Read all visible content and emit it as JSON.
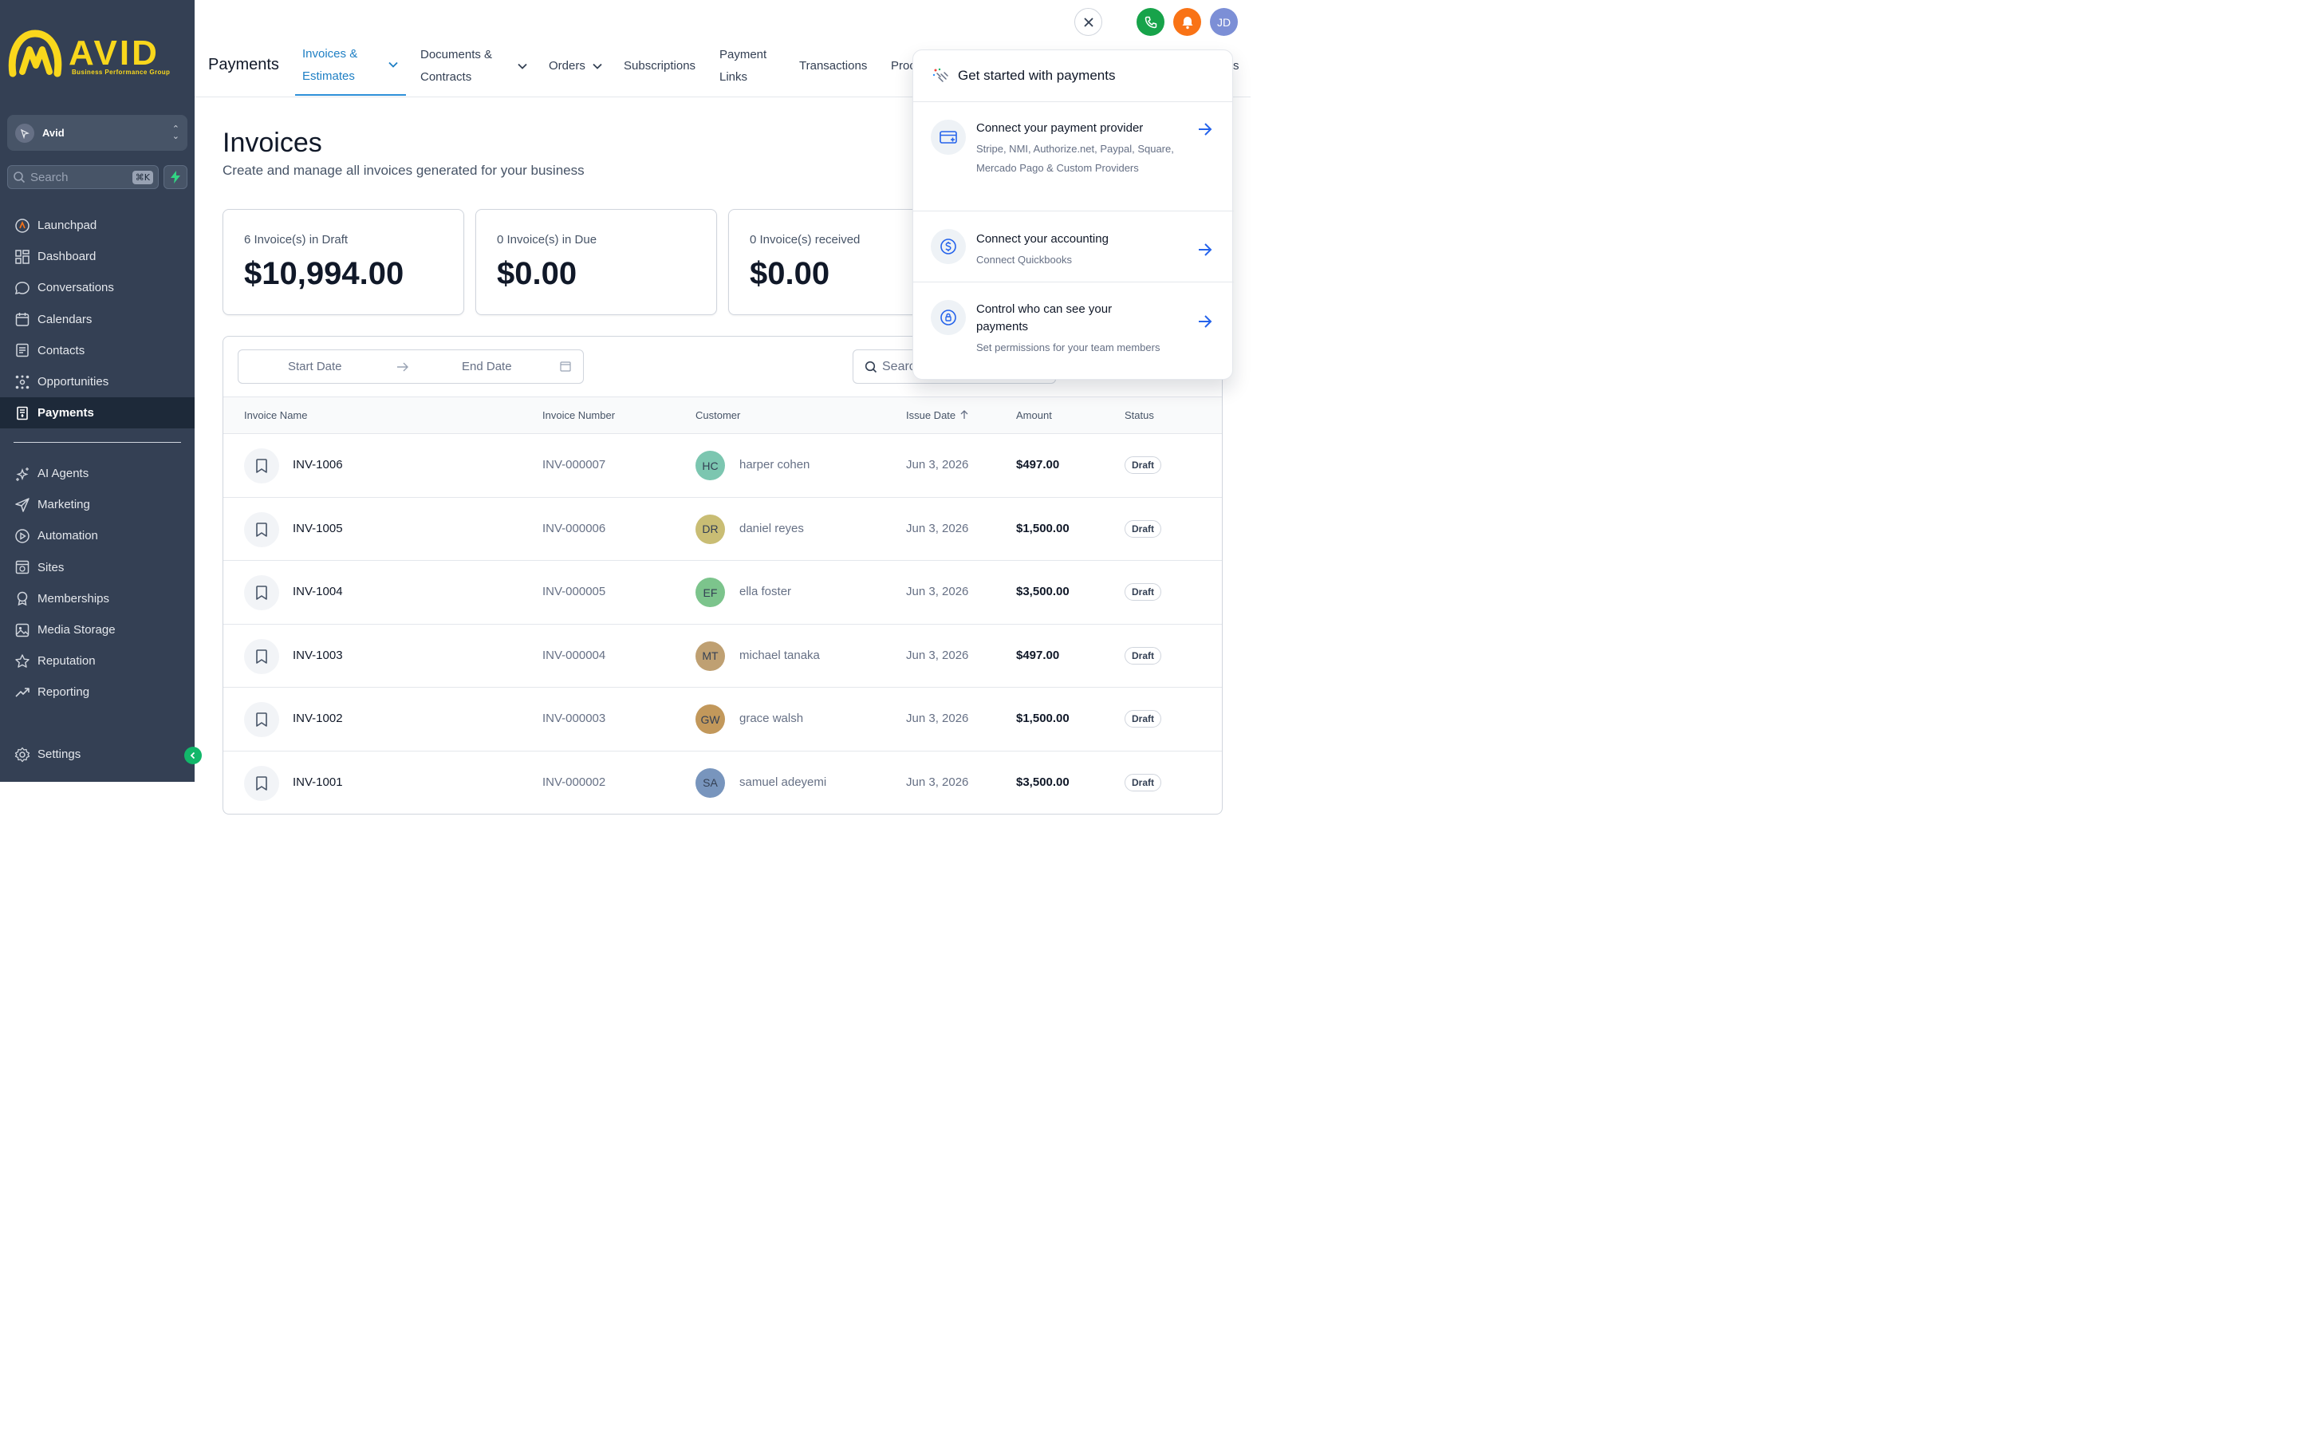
{
  "brand": {
    "name": "AVID",
    "tagline": "Business Performance Group",
    "color": "#f9d71c"
  },
  "sidebar": {
    "account": "Avid",
    "search_placeholder": "Search",
    "search_shortcut": "⌘K",
    "items": [
      {
        "label": "Launchpad",
        "icon": "launchpad-icon"
      },
      {
        "label": "Dashboard",
        "icon": "dashboard-icon"
      },
      {
        "label": "Conversations",
        "icon": "chat-icon"
      },
      {
        "label": "Calendars",
        "icon": "calendar-icon"
      },
      {
        "label": "Contacts",
        "icon": "contacts-icon"
      },
      {
        "label": "Opportunities",
        "icon": "opportunities-icon"
      },
      {
        "label": "Payments",
        "icon": "payments-icon",
        "active": true
      }
    ],
    "items2": [
      {
        "label": "AI Agents",
        "icon": "sparkle-icon"
      },
      {
        "label": "Marketing",
        "icon": "send-icon"
      },
      {
        "label": "Automation",
        "icon": "automation-icon"
      },
      {
        "label": "Sites",
        "icon": "sites-icon"
      },
      {
        "label": "Memberships",
        "icon": "membership-icon"
      },
      {
        "label": "Media Storage",
        "icon": "image-icon"
      },
      {
        "label": "Reputation",
        "icon": "star-icon"
      },
      {
        "label": "Reporting",
        "icon": "trend-icon"
      }
    ],
    "settings": "Settings"
  },
  "header": {
    "title": "Payments",
    "tabs": {
      "invoices_l1": "Invoices &",
      "invoices_l2": "Estimates",
      "documents_l1": "Documents &",
      "documents_l2": "Contracts",
      "orders": "Orders",
      "subscriptions": "Subscriptions",
      "links_l1": "Payment",
      "links_l2": "Links",
      "transactions": "Transactions",
      "products": "Proc",
      "more": "s"
    },
    "avatar": "JD",
    "colors": {
      "phone": "#17a34a",
      "bell": "#f97316",
      "avatar": "#7c8fd6"
    }
  },
  "page": {
    "title": "Invoices",
    "subtitle": "Create and manage all invoices generated for your business"
  },
  "cards": [
    {
      "label": "6 Invoice(s) in Draft",
      "value": "$10,994.00"
    },
    {
      "label": "0 Invoice(s) in Due",
      "value": "$0.00"
    },
    {
      "label": "0 Invoice(s) received",
      "value": "$0.00"
    }
  ],
  "filters": {
    "start_date": "Start Date",
    "end_date": "End Date",
    "search": "Searc"
  },
  "table": {
    "headers": {
      "name": "Invoice Name",
      "number": "Invoice Number",
      "customer": "Customer",
      "issue_date": "Issue Date",
      "amount": "Amount",
      "status": "Status"
    },
    "rows": [
      {
        "name": "INV-1006",
        "number": "INV-000007",
        "initials": "HC",
        "customer": "harper cohen",
        "date": "Jun 3, 2026",
        "amount": "$497.00",
        "status": "Draft",
        "avatar_color": "#7cc6b0"
      },
      {
        "name": "INV-1005",
        "number": "INV-000006",
        "initials": "DR",
        "customer": "daniel reyes",
        "date": "Jun 3, 2026",
        "amount": "$1,500.00",
        "status": "Draft",
        "avatar_color": "#c9bd74"
      },
      {
        "name": "INV-1004",
        "number": "INV-000005",
        "initials": "EF",
        "customer": "ella foster",
        "date": "Jun 3, 2026",
        "amount": "$3,500.00",
        "status": "Draft",
        "avatar_color": "#7cc48c"
      },
      {
        "name": "INV-1003",
        "number": "INV-000004",
        "initials": "MT",
        "customer": "michael tanaka",
        "date": "Jun 3, 2026",
        "amount": "$497.00",
        "status": "Draft",
        "avatar_color": "#bfa072"
      },
      {
        "name": "INV-1002",
        "number": "INV-000003",
        "initials": "GW",
        "customer": "grace walsh",
        "date": "Jun 3, 2026",
        "amount": "$1,500.00",
        "status": "Draft",
        "avatar_color": "#c2985b"
      },
      {
        "name": "INV-1001",
        "number": "INV-000002",
        "initials": "SA",
        "customer": "samuel adeyemi",
        "date": "Jun 3, 2026",
        "amount": "$3,500.00",
        "status": "Draft",
        "avatar_color": "#7895bd"
      }
    ]
  },
  "popover": {
    "title": "Get started with payments",
    "items": [
      {
        "title": "Connect your payment provider",
        "desc": "Stripe, NMI, Authorize.net, Paypal, Square, Mercado Pago & Custom Providers"
      },
      {
        "title": "Connect your accounting",
        "desc": "Connect Quickbooks"
      },
      {
        "title": "Control who can see your payments",
        "desc": "Set permissions for your team members"
      }
    ]
  }
}
